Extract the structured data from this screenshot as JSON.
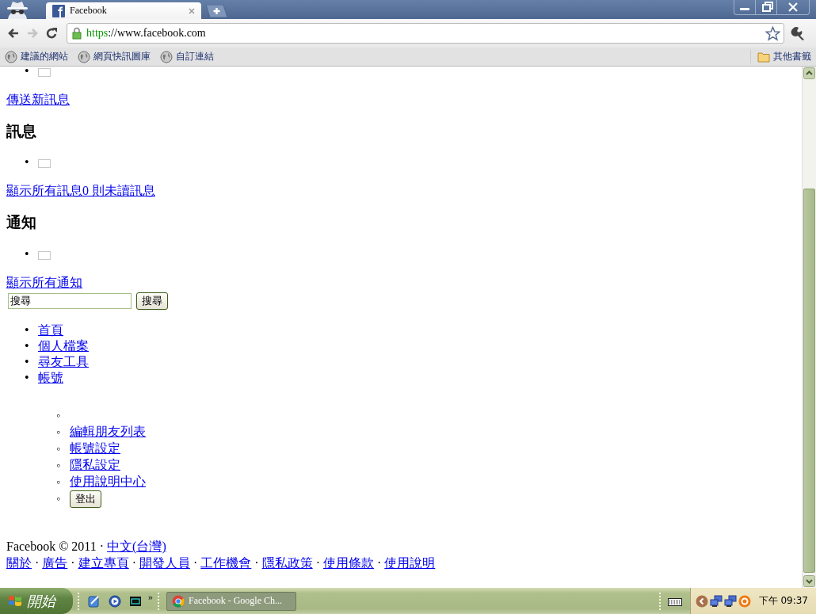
{
  "browser": {
    "tab": {
      "title": "Facebook"
    },
    "url": {
      "scheme": "https",
      "rest": "://www.facebook.com"
    },
    "bookmarks": [
      {
        "label": "建議的網站"
      },
      {
        "label": "網頁快訊圖庫"
      },
      {
        "label": "自訂連結"
      }
    ],
    "other_bookmarks": "其他書籤"
  },
  "page": {
    "bullet": "•",
    "sub_bullet": "◦",
    "sections": [
      {
        "link": "傳送新訊息"
      },
      {
        "heading": "訊息",
        "link": "顯示所有訊息0 則未讀訊息"
      },
      {
        "heading": "通知",
        "link": "顯示所有通知"
      }
    ],
    "search": {
      "value": "搜尋",
      "button": "搜尋"
    },
    "nav": [
      {
        "label": "首頁"
      },
      {
        "label": "個人檔案"
      },
      {
        "label": "尋友工具"
      },
      {
        "label": "帳號",
        "children": [
          {
            "kind": "blank"
          },
          {
            "kind": "link",
            "label": "編輯朋友列表"
          },
          {
            "kind": "link",
            "label": "帳號設定"
          },
          {
            "kind": "link",
            "label": "隱私設定"
          },
          {
            "kind": "link",
            "label": "使用說明中心"
          },
          {
            "kind": "button",
            "label": "登出"
          }
        ]
      }
    ],
    "footer": {
      "copyright": "Facebook © 2011 ·",
      "language": "中文(台灣)",
      "separator": "·",
      "links": [
        "關於",
        "廣告",
        "建立專頁",
        "開發人員",
        "工作機會",
        "隱私政策",
        "使用條款",
        "使用說明"
      ]
    }
  },
  "taskbar": {
    "start": "開始",
    "overflow": "»",
    "tasks": [
      {
        "label": "Facebook - Google Ch..."
      }
    ],
    "clock": "下午 09:37"
  }
}
